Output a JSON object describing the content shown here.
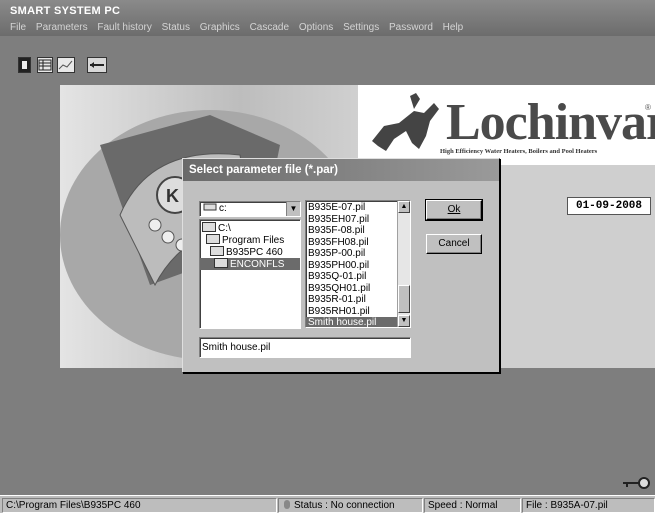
{
  "window": {
    "title": "SMART SYSTEM PC"
  },
  "menu": [
    "File",
    "Parameters",
    "Fault history",
    "Status",
    "Graphics",
    "Cascade",
    "Options",
    "Settings",
    "Password",
    "Help"
  ],
  "toolbar": {
    "icons": [
      "book-icon",
      "table-icon",
      "chart-icon",
      "connect-icon"
    ]
  },
  "brand": {
    "name": "Lochinvar",
    "tagline": "High Efficiency Water Heaters, Boilers and Pool Heaters",
    "registered": "®"
  },
  "date": "01-09-2008",
  "dialog": {
    "title": "Select parameter file (*.par)",
    "drive": "c:",
    "directories": [
      {
        "name": "C:\\",
        "selected": false
      },
      {
        "name": "Program Files",
        "selected": false
      },
      {
        "name": "B935PC 460",
        "selected": false
      },
      {
        "name": "ENCONFLS",
        "selected": true
      }
    ],
    "files": [
      {
        "name": "B935E-07.pil",
        "selected": false
      },
      {
        "name": "B935EH07.pil",
        "selected": false
      },
      {
        "name": "B935F-08.pil",
        "selected": false
      },
      {
        "name": "B935FH08.pil",
        "selected": false
      },
      {
        "name": "B935P-00.pil",
        "selected": false
      },
      {
        "name": "B935PH00.pil",
        "selected": false
      },
      {
        "name": "B935Q-01.pil",
        "selected": false
      },
      {
        "name": "B935QH01.pil",
        "selected": false
      },
      {
        "name": "B935R-01.pil",
        "selected": false
      },
      {
        "name": "B935RH01.pil",
        "selected": false
      },
      {
        "name": "Smith house.pil",
        "selected": true
      }
    ],
    "ok_label": "Ok",
    "cancel_label": "Cancel",
    "filename_value": "Smith house.pil"
  },
  "status": {
    "path": "C:\\Program Files\\B935PC 460",
    "connection": "Status : No connection",
    "speed": "Speed : Normal",
    "file": "File : B935A-07.pil"
  }
}
